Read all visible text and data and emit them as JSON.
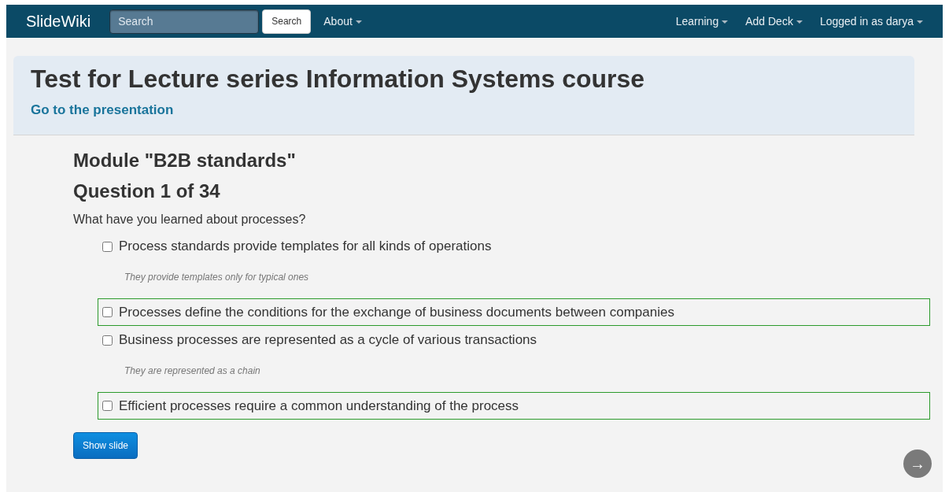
{
  "navbar": {
    "brand": "SlideWiki",
    "search": {
      "placeholder": "Search",
      "button": "Search"
    },
    "left_menus": [
      {
        "label": "About"
      }
    ],
    "right_menus": [
      {
        "label": "Learning"
      },
      {
        "label": "Add Deck"
      },
      {
        "label": "Logged in as darya"
      }
    ]
  },
  "header": {
    "title": "Test for Lecture series Information Systems course",
    "link": "Go to the presentation"
  },
  "module": "Module \"B2B standards\"",
  "question_counter": "Question 1 of 34",
  "question": "What have you learned about processes?",
  "answers": [
    {
      "text": "Process standards provide templates for all kinds of operations",
      "checked": false,
      "correct": false,
      "explanation": "They provide templates only for typical ones"
    },
    {
      "text": "Processes define the conditions for the exchange of business documents between companies",
      "checked": false,
      "correct": true
    },
    {
      "text": "Business processes are represented as a cycle of various transactions",
      "checked": false,
      "correct": false,
      "explanation": "They are represented as a chain"
    },
    {
      "text": "Efficient processes require a common understanding of the process",
      "checked": false,
      "correct": true
    }
  ],
  "show_button": "Show slide",
  "next_button": "→"
}
